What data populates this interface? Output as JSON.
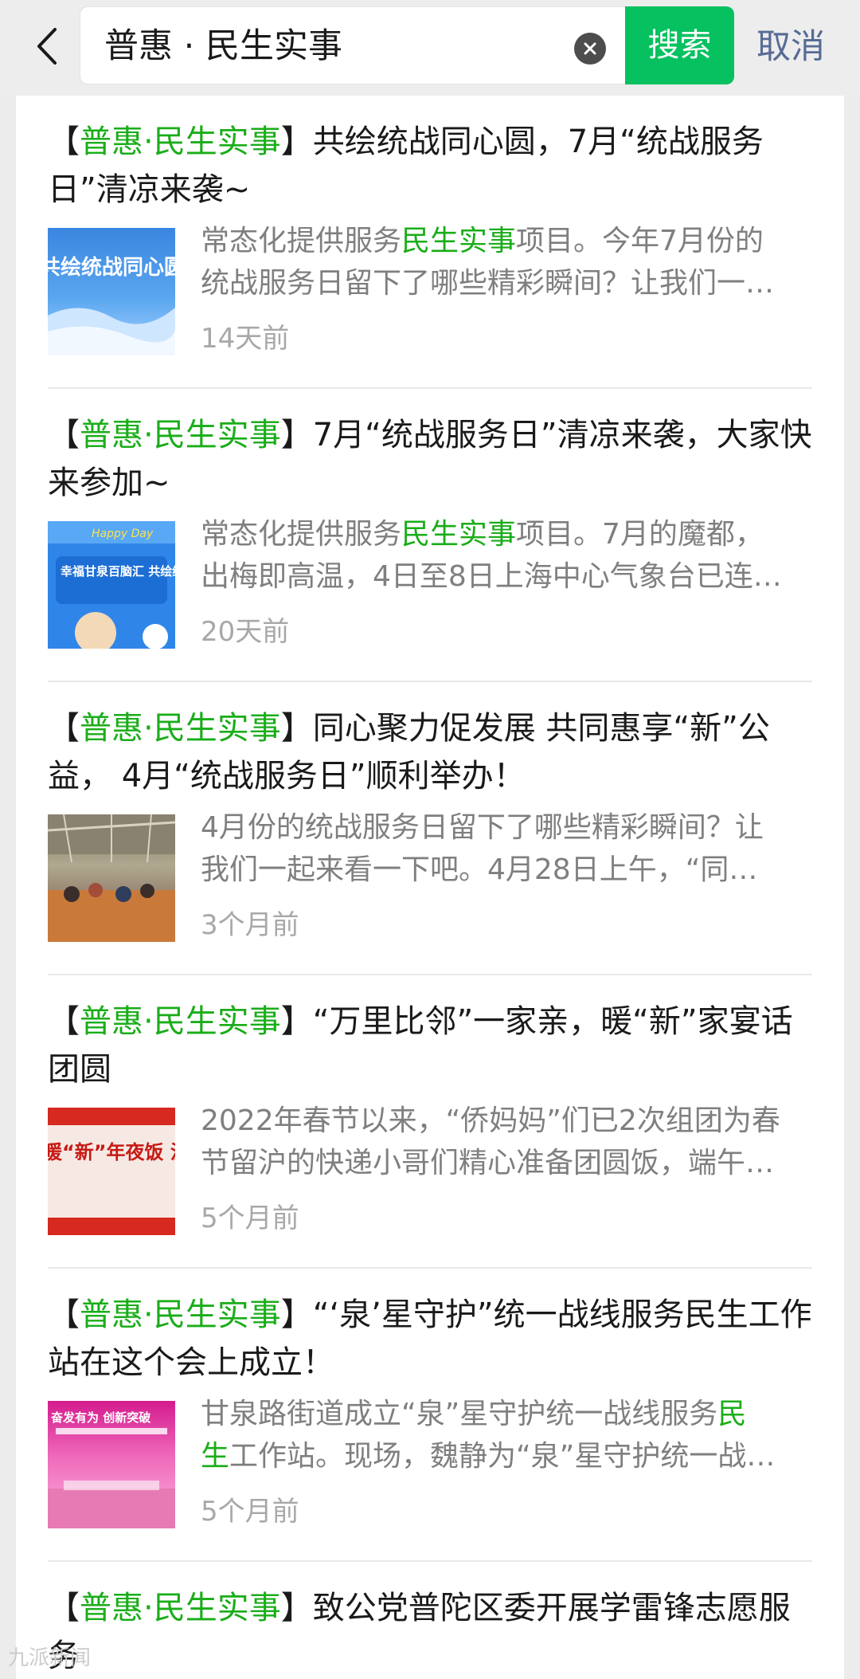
{
  "search": {
    "query": "普惠 · 民生实事",
    "button_label": "搜索",
    "cancel_label": "取消"
  },
  "results": [
    {
      "title_highlight": "普惠·民生实事",
      "title_rest": "共绘统战同心圆，7月“统战服务日”清凉来袭~",
      "desc_line1_pre": "常态化提供服务",
      "desc_line1_hl": "民生实事",
      "desc_line1_post": "项目。今年7月份的",
      "desc_line2": "统战服务日留下了哪些精彩瞬间？让我们一…",
      "time": "14天前",
      "thumb_text": "共绘统战同心圆"
    },
    {
      "title_highlight": "普惠·民生实事",
      "title_rest": "7月“统战服务日”清凉来袭，大家快来参加~",
      "desc_line1_pre": "常态化提供服务",
      "desc_line1_hl": "民生实事",
      "desc_line1_post": "项目。7月的魔都，",
      "desc_line2": "出梅即高温，4日至8日上海中心气象台已连…",
      "time": "20天前",
      "thumb_text": "幸福甘泉百脑汇 共绘统战同心圆",
      "thumb_small": "Happy Day"
    },
    {
      "title_highlight": "普惠·民生实事",
      "title_rest": "同心聚力促发展 共同惠享“新”公益， 4月“统战服务日”顺利举办！",
      "desc_line1_pre": "4月份的统战服务日留下了哪些精彩瞬间？让",
      "desc_line1_hl": "",
      "desc_line1_post": "",
      "desc_line2": "我们一起来看一下吧。4月28日上午，“同…",
      "time": "3个月前"
    },
    {
      "title_highlight": "普惠·民生实事",
      "title_rest": "“万里比邻”一家亲，暖“新”家宴话团圆",
      "desc_line1_pre": "2022年春节以来，“侨妈妈”们已2次组团为春",
      "desc_line1_hl": "",
      "desc_line1_post": "",
      "desc_line2": "节留沪的快递小哥们精心准备团圆饭，端午…",
      "time": "5个月前",
      "thumb_text": "暖“新”年夜饭 温情共话团圆"
    },
    {
      "title_highlight": "普惠·民生实事",
      "title_rest": "“‘泉’星守护”统一战线服务民生工作站在这个会上成立！",
      "desc_line1_pre": "甘泉路街道成立“泉”星守护统一战线服务",
      "desc_line1_hl": "民",
      "desc_line1_post": "",
      "desc_line2_hl": "生",
      "desc_line2": "工作站。现场，魏静为“泉”星守护统一战…",
      "time": "5个月前",
      "thumb_text": "奋发有为 创新突破"
    },
    {
      "title_highlight": "普惠·民生实事",
      "title_rest": "致公党普陀区委开展学雷锋志愿服务"
    }
  ],
  "watermark": "九派新闻"
}
